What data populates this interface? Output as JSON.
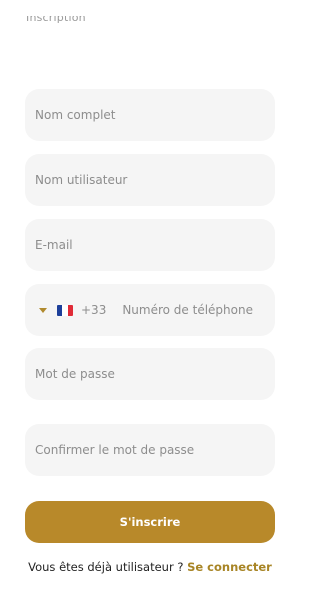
{
  "header": {
    "clipped_text": "Inscription"
  },
  "form": {
    "full_name_placeholder": "Nom complet",
    "username_placeholder": "Nom utilisateur",
    "email_placeholder": "E-mail",
    "phone": {
      "country_flag": "france-flag-icon",
      "dial_code": "+33",
      "placeholder": "Numéro de téléphone"
    },
    "password_placeholder": "Mot de passe",
    "confirm_password_placeholder": "Confirmer le mot de passe",
    "submit_label": "S'inscrire"
  },
  "footer": {
    "question": "Vous êtes déjà utilisateur ? ",
    "login_link": "Se connecter"
  },
  "colors": {
    "accent": "#b8892a",
    "field_background": "#f5f5f5",
    "link": "#a88526"
  }
}
